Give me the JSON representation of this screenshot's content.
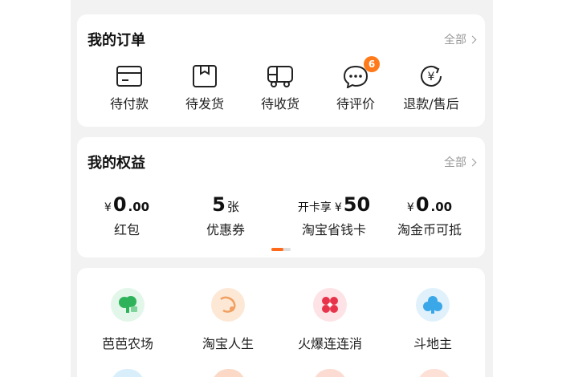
{
  "orders": {
    "title": "我的订单",
    "all_label": "全部",
    "items": [
      {
        "label": "待付款",
        "icon": "wallet-card-icon"
      },
      {
        "label": "待发货",
        "icon": "package-box-icon"
      },
      {
        "label": "待收货",
        "icon": "delivery-truck-icon"
      },
      {
        "label": "待评价",
        "icon": "comment-bubble-icon",
        "badge": "6"
      },
      {
        "label": "退款/售后",
        "icon": "refund-yen-icon"
      }
    ]
  },
  "benefits": {
    "title": "我的权益",
    "all_label": "全部",
    "items": [
      {
        "symbol": "¥",
        "big": "0",
        "small": ".00",
        "label": "红包"
      },
      {
        "big": "5",
        "unit": "张",
        "label": "优惠券"
      },
      {
        "prefix": "开卡享",
        "symbol": "¥",
        "big": "50",
        "label": "淘宝省钱卡"
      },
      {
        "symbol": "¥",
        "big": "0",
        "small": ".00",
        "label": "淘金币可抵"
      }
    ]
  },
  "games": {
    "items": [
      {
        "label": "芭芭农场",
        "icon": "farm-tree-icon",
        "bg": "#e3f6ea",
        "fg": "#2fb35a"
      },
      {
        "label": "淘宝人生",
        "icon": "taobao-life-icon",
        "bg": "#fde8d6",
        "fg": "#f0a060"
      },
      {
        "label": "火爆连连消",
        "icon": "match-game-icon",
        "bg": "#fde3e6",
        "fg": "#e8344a"
      },
      {
        "label": "斗地主",
        "icon": "poker-club-icon",
        "bg": "#e0f1fc",
        "fg": "#3aa7e8"
      }
    ]
  },
  "colors": {
    "accent": "#ff6a1a",
    "badge": "#ff7a1a",
    "muted": "#999999"
  }
}
